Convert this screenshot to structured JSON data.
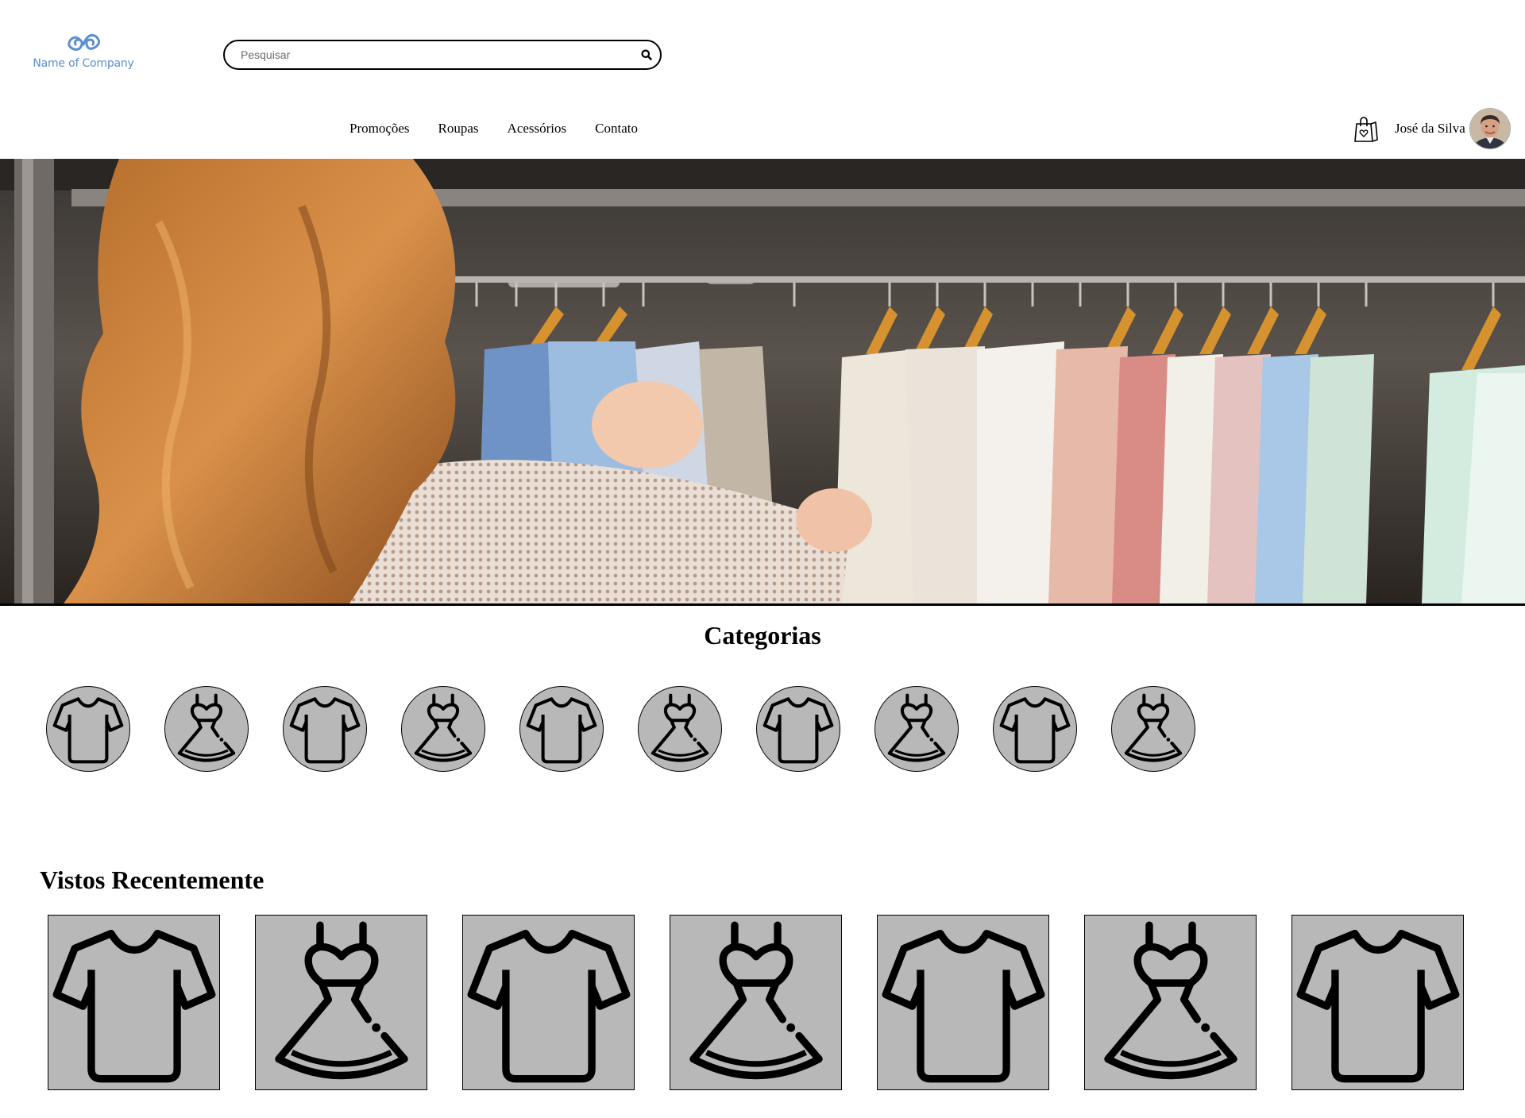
{
  "header": {
    "logo_text": "Name of Company",
    "search": {
      "placeholder": "Pesquisar",
      "value": ""
    },
    "nav": [
      "Promoções",
      "Roupas",
      "Acessórios",
      "Contato"
    ],
    "user_name": "José da Silva"
  },
  "hero": {
    "image": "woman-browsing-clothes-rack"
  },
  "categories": {
    "title": "Categorias",
    "items": [
      "tshirt-icon",
      "dress-icon",
      "tshirt-icon",
      "dress-icon",
      "tshirt-icon",
      "dress-icon",
      "tshirt-icon",
      "dress-icon",
      "tshirt-icon",
      "dress-icon"
    ]
  },
  "recent": {
    "title": "Vistos Recentemente",
    "items": [
      "tshirt-icon",
      "dress-icon",
      "tshirt-icon",
      "dress-icon",
      "tshirt-icon",
      "dress-icon",
      "tshirt-icon"
    ]
  },
  "colors": {
    "tile_bg": "#b8b8b8",
    "logo_blue": "#5b8fd0"
  }
}
